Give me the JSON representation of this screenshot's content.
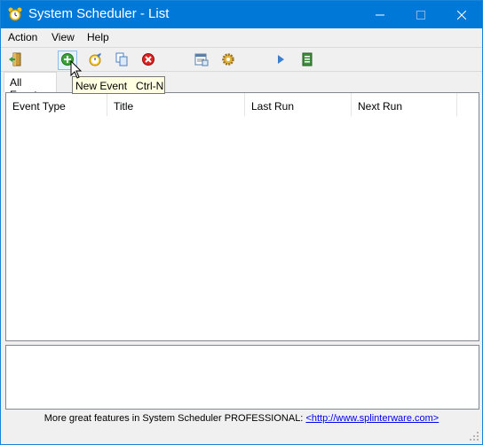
{
  "window": {
    "title": "System Scheduler - List"
  },
  "menu": {
    "items": [
      "Action",
      "View",
      "Help"
    ]
  },
  "toolbar": {
    "buttons": [
      {
        "name": "exit",
        "icon": "exit-icon"
      },
      {
        "name": "new-event",
        "icon": "add-icon"
      },
      {
        "name": "edit-event",
        "icon": "edit-clock-icon"
      },
      {
        "name": "copy-event",
        "icon": "copy-icon"
      },
      {
        "name": "delete-event",
        "icon": "delete-icon"
      },
      {
        "name": "view-log",
        "icon": "log-icon"
      },
      {
        "name": "preferences",
        "icon": "gear-icon"
      },
      {
        "name": "run-now",
        "icon": "play-icon"
      },
      {
        "name": "export",
        "icon": "export-icon"
      }
    ]
  },
  "tooltip": {
    "text": "New Event   Ctrl-N"
  },
  "tabs": [
    {
      "label": "All Events",
      "selected": true
    }
  ],
  "list": {
    "columns": [
      "Event Type",
      "Title",
      "Last Run",
      "Next Run"
    ],
    "rows": []
  },
  "footer": {
    "text": "More great features in System Scheduler PROFESSIONAL: ",
    "link": "<http://www.splinterware.com>"
  },
  "colors": {
    "titlebar": "#0078d7",
    "tooltip_bg": "#ffffe1",
    "link": "#0000ee"
  }
}
